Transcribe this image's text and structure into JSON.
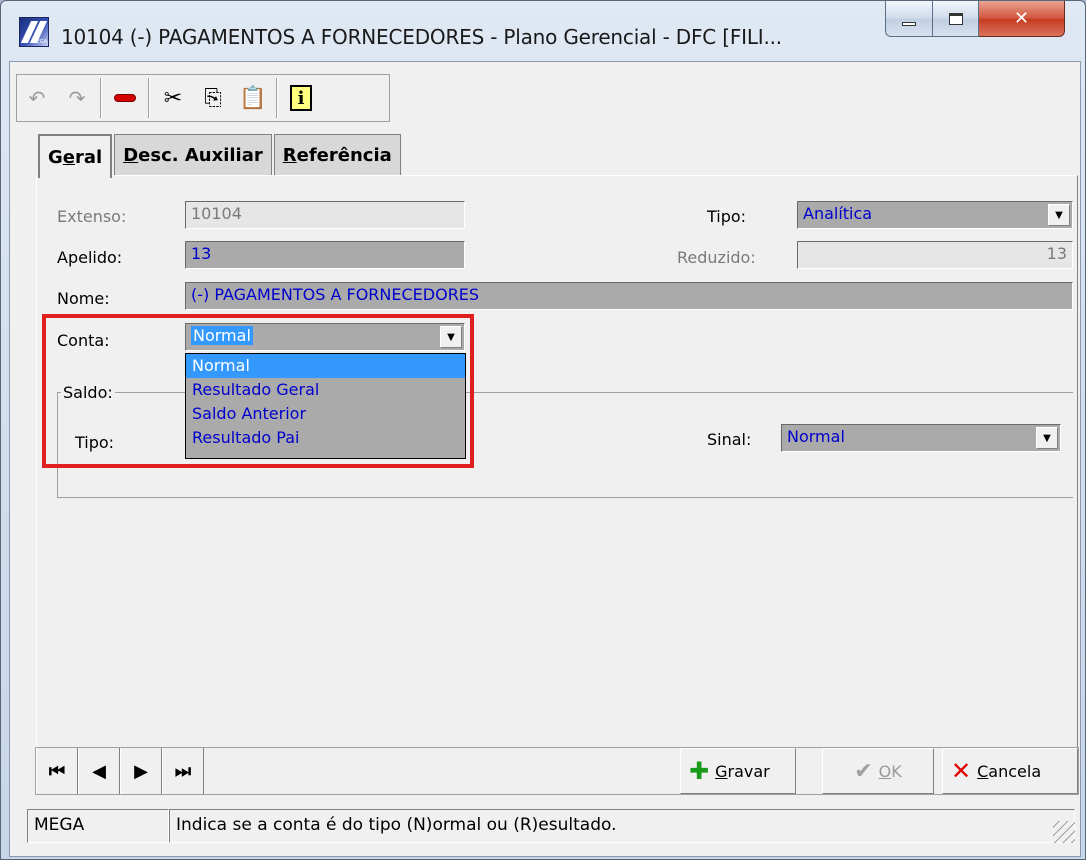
{
  "window": {
    "title": "10104 (-) PAGAMENTOS A FORNECEDORES -  Plano Gerencial - DFC [FILI...",
    "app_icon_text": "MEGA"
  },
  "toolbar": {
    "undo_icon": "undo-icon",
    "redo_icon": "redo-icon",
    "delete_icon": "delete-record-icon",
    "cut_icon": "scissors-icon",
    "copy_icon": "copy-icon",
    "paste_icon": "paste-icon",
    "info_icon": "info-icon"
  },
  "tabs": {
    "geral": {
      "pre": "G",
      "u": "e",
      "post": "ral"
    },
    "desc": {
      "pre": "",
      "u": "D",
      "post": "esc. Auxiliar"
    },
    "ref": {
      "pre": "",
      "u": "R",
      "post": "eferência"
    }
  },
  "form": {
    "extenso_label": "Extenso:",
    "extenso_value": "10104",
    "apelido_label": "Apelido:",
    "apelido_value": "13",
    "nome_label": "Nome:",
    "nome_value": "(-) PAGAMENTOS A FORNECEDORES",
    "tipo_label": "Tipo:",
    "tipo_value": "Analítica",
    "reduzido_label": "Reduzido:",
    "reduzido_value": "13",
    "conta_label": "Conta:",
    "conta_value": "Normal",
    "conta_options": [
      "Normal",
      "Resultado Geral",
      "Saldo Anterior",
      "Resultado Pai"
    ],
    "saldo_group": "Saldo:",
    "saldo_tipo_label": "Tipo:",
    "sinal_label": "Sinal:",
    "sinal_value": "Normal"
  },
  "nav": {
    "first": "⏮",
    "prev": "◀",
    "next": "▶",
    "last": "⏭"
  },
  "actions": {
    "gravar": {
      "u": "G",
      "rest": "ravar"
    },
    "ok": {
      "u": "O",
      "rest": "K"
    },
    "cancela": {
      "u": "C",
      "rest": "ancela"
    }
  },
  "status": {
    "left": "MEGA",
    "message": "Indica se a conta é do tipo (N)ormal ou (R)esultado."
  },
  "colors": {
    "value_text": "#0000cc",
    "selection": "#3399ff",
    "highlight_box": "#e02020"
  }
}
